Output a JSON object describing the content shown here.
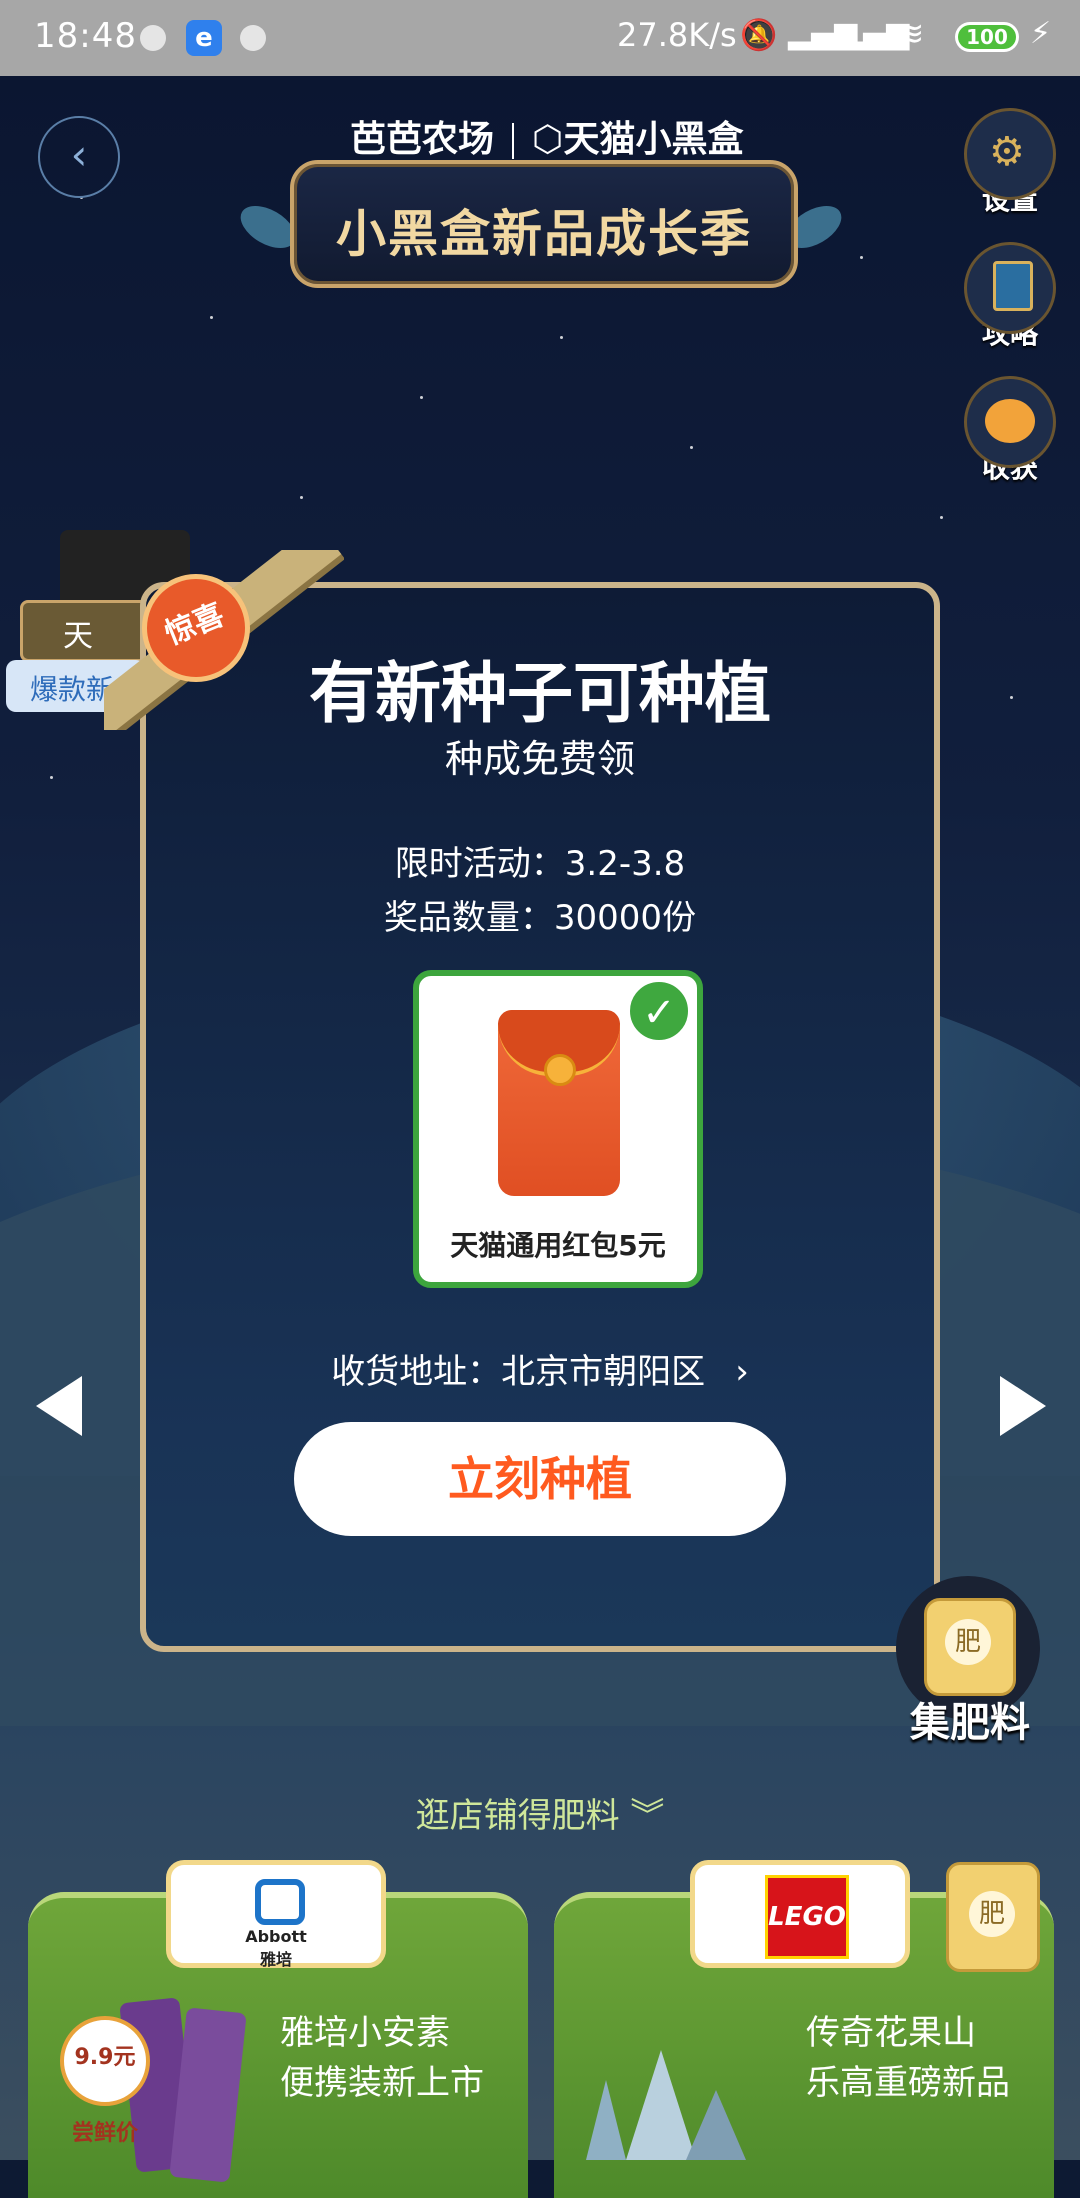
{
  "status_bar": {
    "time": "18:48",
    "net_speed": "27.8K/s",
    "battery": "100",
    "app_icon": "e"
  },
  "header": {
    "brand_left": "芭芭农场",
    "brand_right": "天猫小黑盒",
    "banner_title": "小黑盒新品成长季"
  },
  "side_buttons": [
    {
      "label": "设置",
      "icon": "gear-icon"
    },
    {
      "label": "攻略",
      "icon": "book-icon"
    },
    {
      "label": "收获",
      "icon": "harvest-icon"
    }
  ],
  "left_tag": {
    "box_label": "天",
    "text": "爆款新品"
  },
  "modal": {
    "badge": "惊喜",
    "title": "有新种子可种植",
    "subtitle": "种成免费领",
    "info_time": "限时活动：3.2-3.8",
    "info_count": "奖品数量：30000份",
    "prize_label": "天猫通用红包5元",
    "address": "收货地址：北京市朝阳区",
    "cta": "立刻种植"
  },
  "fertilizer": {
    "bag": "肥",
    "label": "集肥料"
  },
  "browse_text": "逛店铺得肥料",
  "shops": [
    {
      "logo_brand": "Abbott",
      "logo_sub": "雅培",
      "line1": "雅培小安素",
      "line2": "便携装新上市",
      "price_badge": "9.9元\n尝鲜价"
    },
    {
      "logo_brand": "LEGO",
      "line1": "传奇花果山",
      "line2": "乐高重磅新品",
      "bag": "肥"
    }
  ],
  "colors": {
    "accent": "#ff5a1f",
    "check": "#3fa83f",
    "gold": "#cbb48a"
  }
}
